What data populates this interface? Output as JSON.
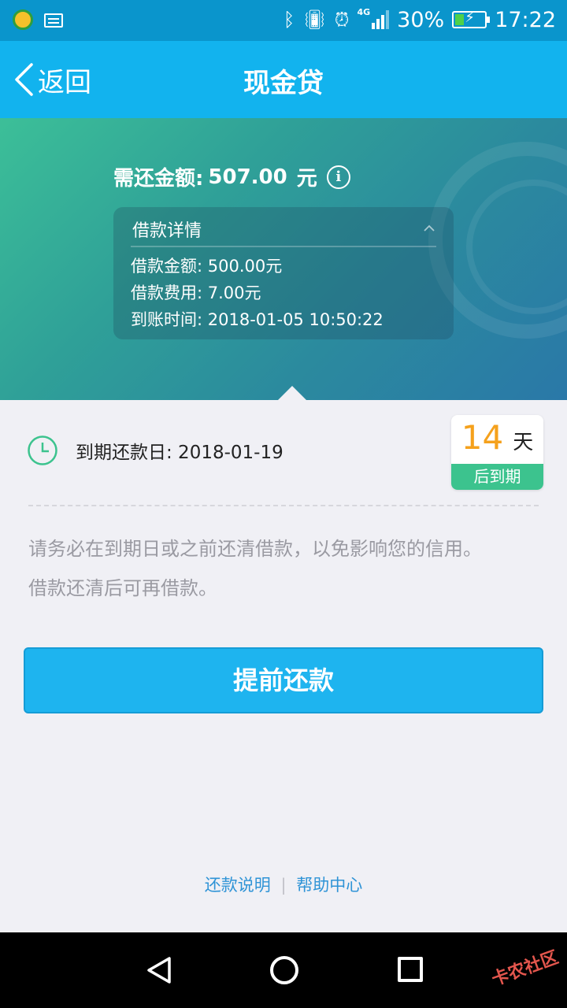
{
  "status_bar": {
    "battery": "30%",
    "battery_level": 0.3,
    "network": "4G",
    "time": "17:22"
  },
  "nav": {
    "back_label": "返回",
    "title": "现金贷"
  },
  "hero": {
    "amount_label": "需还金额:",
    "amount_value": "507.00",
    "amount_unit": "元",
    "info_glyph": "i",
    "detail": {
      "title": "借款详情",
      "lines": [
        "借款金额: 500.00元",
        "借款费用: 7.00元",
        "到账时间: 2018-01-05 10:50:22"
      ]
    }
  },
  "due": {
    "label": "到期还款日: 2018-01-19",
    "countdown_number": "14",
    "countdown_unit": "天",
    "countdown_caption": "后到期"
  },
  "notice": {
    "line1": "请务必在到期日或之前还清借款，以免影响您的信用。",
    "line2": "借款还清后可再借款。"
  },
  "actions": {
    "repay_early": "提前还款"
  },
  "footer": {
    "link1": "还款说明",
    "separator": "|",
    "link2": "帮助中心"
  },
  "system_nav": {
    "watermark": "卡农社区"
  },
  "colors": {
    "primary": "#12b3ee",
    "accent_orange": "#f5a11c",
    "accent_green": "#3cc38e",
    "link": "#2e93d6"
  }
}
